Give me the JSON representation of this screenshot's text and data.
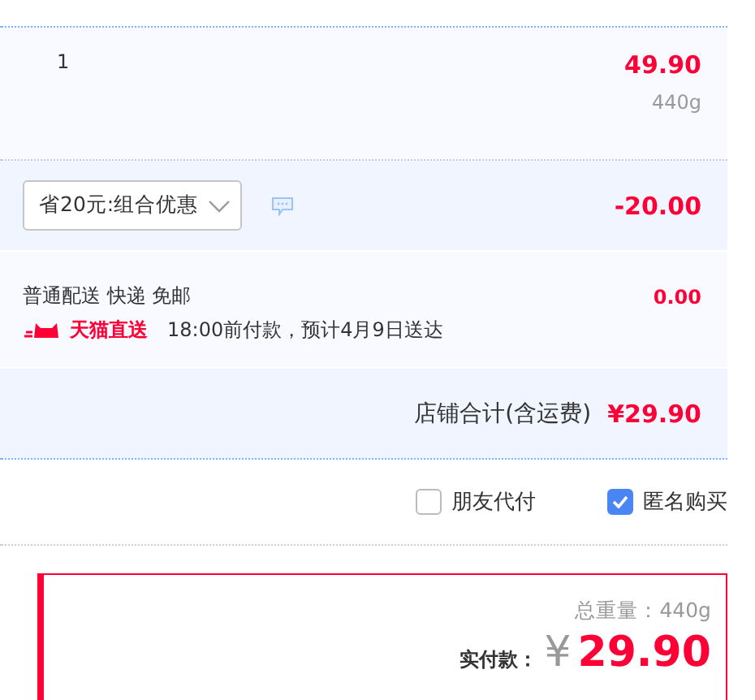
{
  "item": {
    "quantity": "1",
    "price": "49.90",
    "weight": "440g"
  },
  "promotion": {
    "selected_option": "省20元:组合优惠",
    "discount": "-20.00"
  },
  "shipping": {
    "method": "普通配送 快递 免邮",
    "fee": "0.00",
    "carrier_badge": "天猫直送",
    "eta": "18:00前付款，预计4月9日送达"
  },
  "store_total": {
    "label": "店铺合计(含运费)",
    "amount": "¥29.90"
  },
  "options": [
    {
      "label": "朋友代付",
      "checked": false
    },
    {
      "label": "匿名购买",
      "checked": true
    }
  ],
  "summary": {
    "weight": "总重量：440g",
    "pay_label": "实付款：",
    "currency": "¥",
    "amount": "29.90"
  }
}
